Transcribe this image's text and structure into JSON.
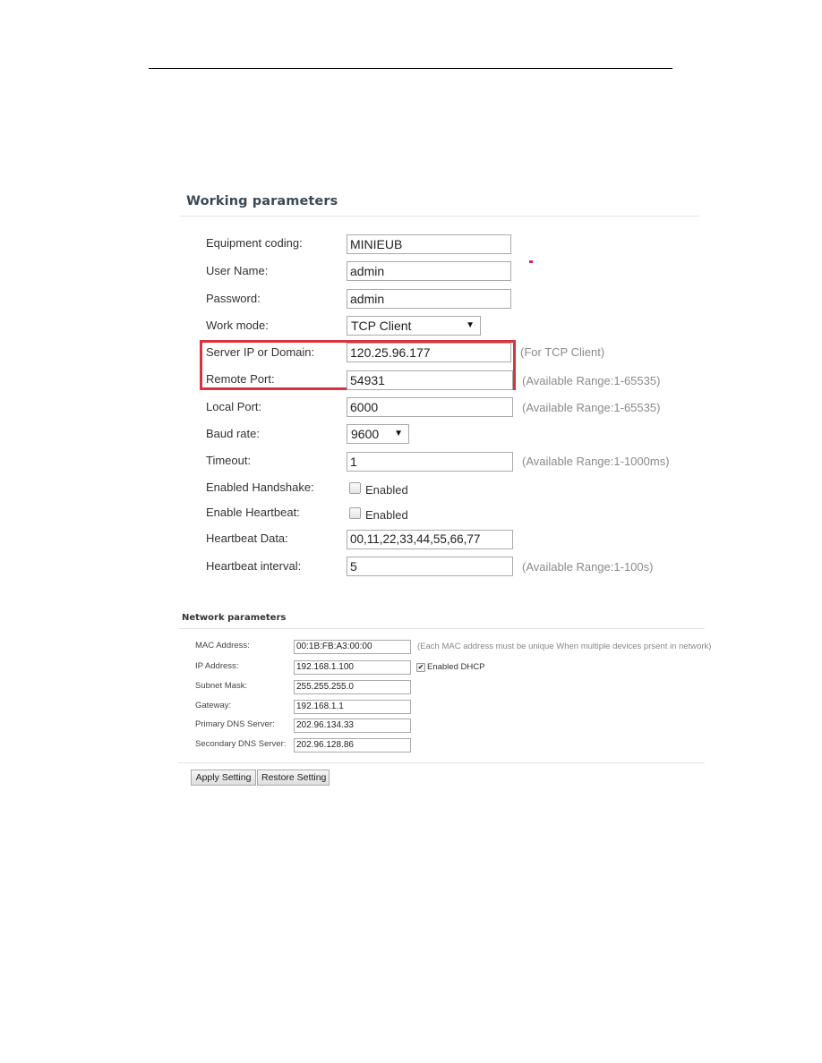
{
  "working_parameters": {
    "title": "Working parameters",
    "fields": {
      "equipment_coding": {
        "label": "Equipment coding:",
        "value": "MINIEUB"
      },
      "user_name": {
        "label": "User Name:",
        "value": "admin"
      },
      "password": {
        "label": "Password:",
        "value": "admin"
      },
      "work_mode": {
        "label": "Work mode:",
        "value": "TCP Client",
        "arrow": "▼"
      },
      "server_ip": {
        "label": "Server IP or Domain:",
        "value": "120.25.96.177",
        "hint": "(For TCP Client)"
      },
      "remote_port": {
        "label": "Remote Port:",
        "value": "54931",
        "hint": "(Available Range:1-65535)"
      },
      "local_port": {
        "label": "Local Port:",
        "value": "6000",
        "hint": "(Available Range:1-65535)"
      },
      "baud_rate": {
        "label": "Baud rate:",
        "value": "9600",
        "arrow": "▼"
      },
      "timeout": {
        "label": "Timeout:",
        "value": "1",
        "hint": "(Available Range:1-1000ms)"
      },
      "handshake": {
        "label": "Enabled Handshake:",
        "checkbox_label": "Enabled",
        "checked": false
      },
      "heartbeat": {
        "label": "Enable Heartbeat:",
        "checkbox_label": "Enabled",
        "checked": false
      },
      "heartbeat_data": {
        "label": "Heartbeat Data:",
        "value": "00,11,22,33,44,55,66,77"
      },
      "heartbeat_interval": {
        "label": "Heartbeat interval:",
        "value": "5",
        "hint": "(Available Range:1-100s)"
      }
    },
    "highlight_color": "#d9333f"
  },
  "network_parameters": {
    "title": "Network parameters",
    "fields": {
      "mac": {
        "label": "MAC Address:",
        "value": "00:1B:FB:A3:00:00",
        "hint": "(Each MAC address must be unique When multiple devices prsent in network)"
      },
      "ip": {
        "label": "IP Address:",
        "value": "192.168.1.100",
        "dhcp_label": "Enabled DHCP",
        "dhcp_checked": true,
        "check_glyph": "✔"
      },
      "subnet": {
        "label": "Subnet Mask:",
        "value": "255.255.255.0"
      },
      "gateway": {
        "label": "Gateway:",
        "value": "192.168.1.1"
      },
      "dns1": {
        "label": "Primary DNS Server:",
        "value": "202.96.134.33"
      },
      "dns2": {
        "label": "Secondary DNS Server:",
        "value": "202.96.128.86"
      }
    }
  },
  "buttons": {
    "apply": "Apply Setting",
    "restore": "Restore Setting"
  }
}
